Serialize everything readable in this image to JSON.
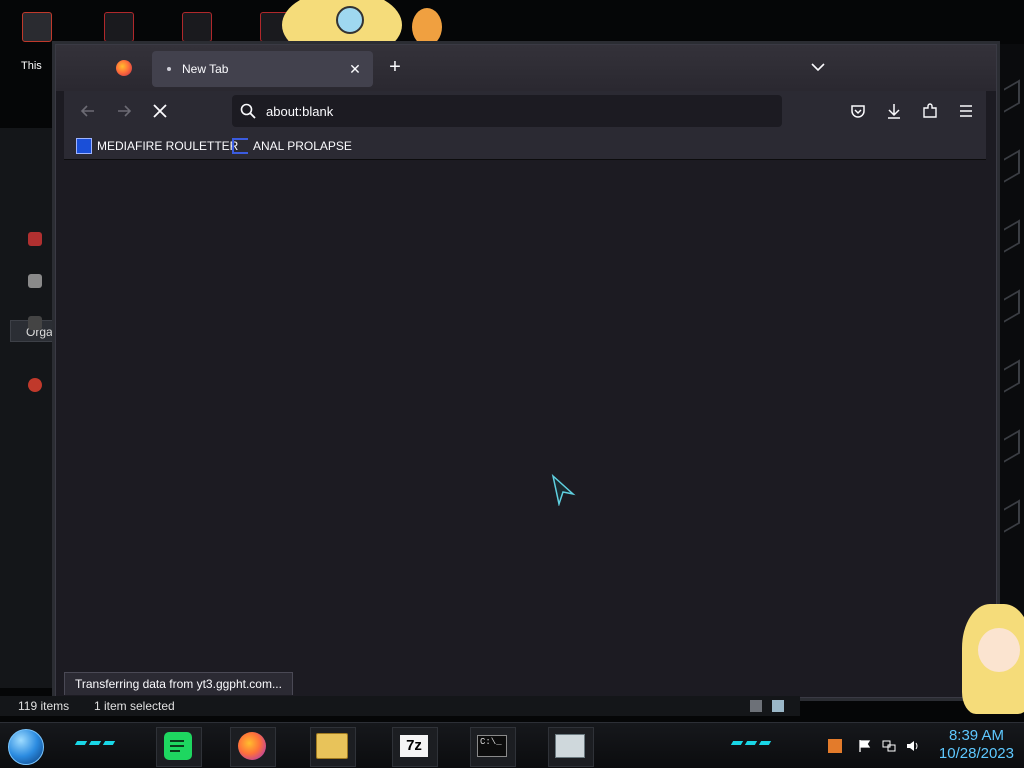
{
  "desktop": {
    "icon_label": "This"
  },
  "explorer_bg": {
    "organize_label": "Orga",
    "items_count": "119 items",
    "selection": "1 item selected"
  },
  "browser": {
    "tab": {
      "title": "New Tab",
      "close_glyph": "✕"
    },
    "new_tab_glyph": "+",
    "url": "about:blank",
    "bookmarks": [
      {
        "label": "MEDIAFIRE ROULETTER",
        "icon": "mediafire-icon",
        "color": "#1a4fd8"
      },
      {
        "label": "ANAL PROLAPSE",
        "icon": "bracket-icon",
        "color": "#3b5ce0"
      }
    ],
    "status_text": "Transferring data from yt3.ggpht.com...",
    "accent": "#42414d"
  },
  "taskbar": {
    "apps": [
      {
        "name": "spotify-icon",
        "color": "#1ed760"
      },
      {
        "name": "firefox-icon",
        "color": "#ff7139"
      },
      {
        "name": "file-explorer-icon",
        "color": "#e8c35a"
      },
      {
        "name": "7zip-icon",
        "label": "7z"
      },
      {
        "name": "terminal-icon",
        "label": "C:\\_"
      },
      {
        "name": "notepad-icon",
        "color": "#cfd8dc"
      }
    ],
    "time": "8:39 AM",
    "date": "10/28/2023"
  }
}
